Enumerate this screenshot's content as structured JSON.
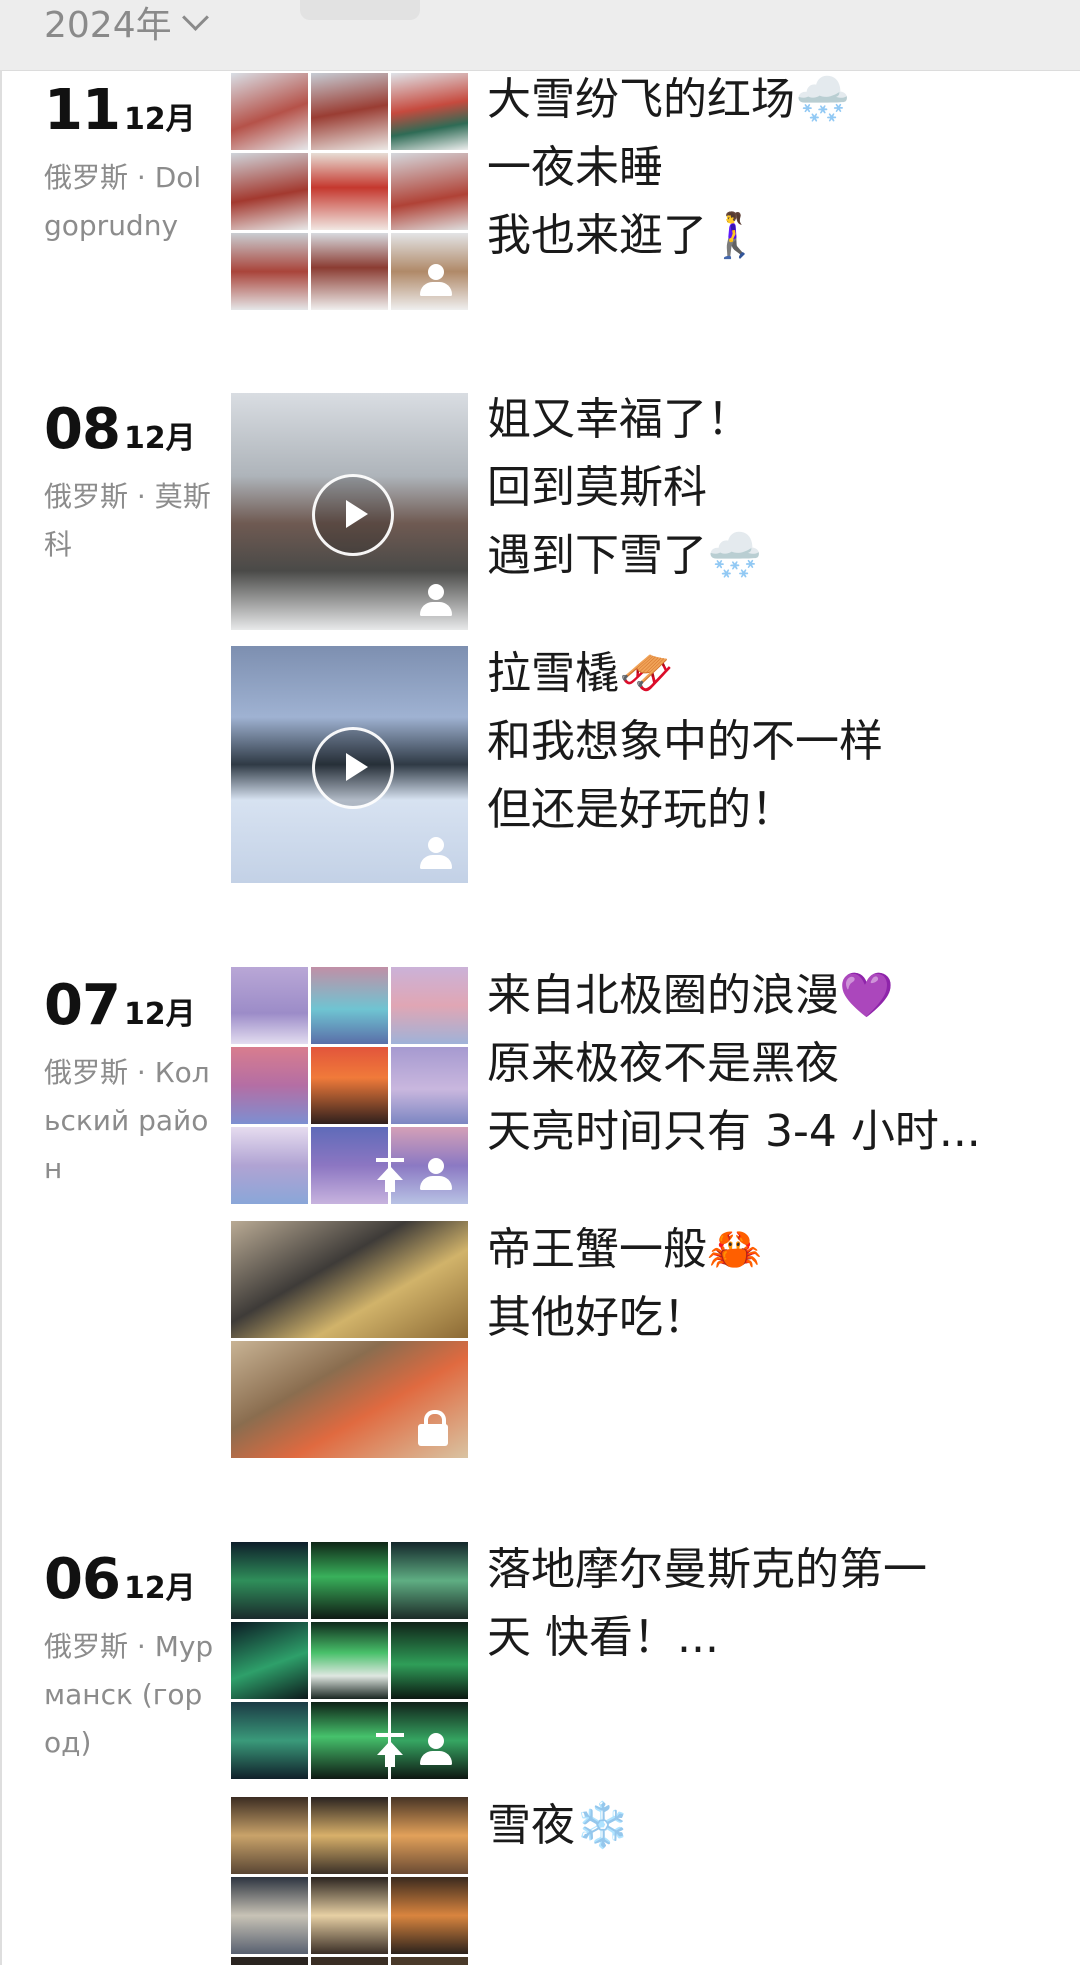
{
  "header": {
    "year_label": "2024年"
  },
  "entries": [
    {
      "day": "11",
      "month": "12月",
      "location": "俄罗斯 · Dolgoprudny",
      "posts": [
        {
          "caption": "大雪纷飞的红场🌨️\n一夜未睡\n我也来逛了🚶‍♀️",
          "media": "9-photo",
          "icons": [
            "person-icon"
          ]
        }
      ]
    },
    {
      "day": "08",
      "month": "12月",
      "location": "俄罗斯 · 莫斯科",
      "posts": [
        {
          "caption": "姐又幸福了！\n回到莫斯科\n遇到下雪了🌨️",
          "media": "video",
          "icons": [
            "play-icon",
            "person-icon"
          ]
        },
        {
          "caption": "拉雪橇🛷\n和我想象中的不一样\n但还是好玩的！",
          "media": "video",
          "icons": [
            "play-icon",
            "person-icon"
          ]
        }
      ]
    },
    {
      "day": "07",
      "month": "12月",
      "location": "俄罗斯 · Кольский район",
      "posts": [
        {
          "caption": "来自北极圈的浪漫💜\n原来极夜不是黑夜\n天亮时间只有 3-4 小时...",
          "media": "9-photo",
          "icons": [
            "upload-icon",
            "person-icon"
          ]
        },
        {
          "caption": "帝王蟹一般🦀\n其他好吃！",
          "media": "2-photo",
          "icons": [
            "lock-icon"
          ]
        }
      ]
    },
    {
      "day": "06",
      "month": "12月",
      "location": "俄罗斯 · Мурманск (город)",
      "posts": [
        {
          "caption": "落地摩尔曼斯克的第一天\n快看！...",
          "media": "9-photo",
          "icons": [
            "upload-icon",
            "person-icon"
          ]
        },
        {
          "caption": "雪夜❄️",
          "media": "9-photo",
          "icons": []
        }
      ]
    }
  ],
  "colors": {
    "topbar": "#ededed",
    "location_text": "#8c8c8c",
    "date_text": "#111111"
  }
}
